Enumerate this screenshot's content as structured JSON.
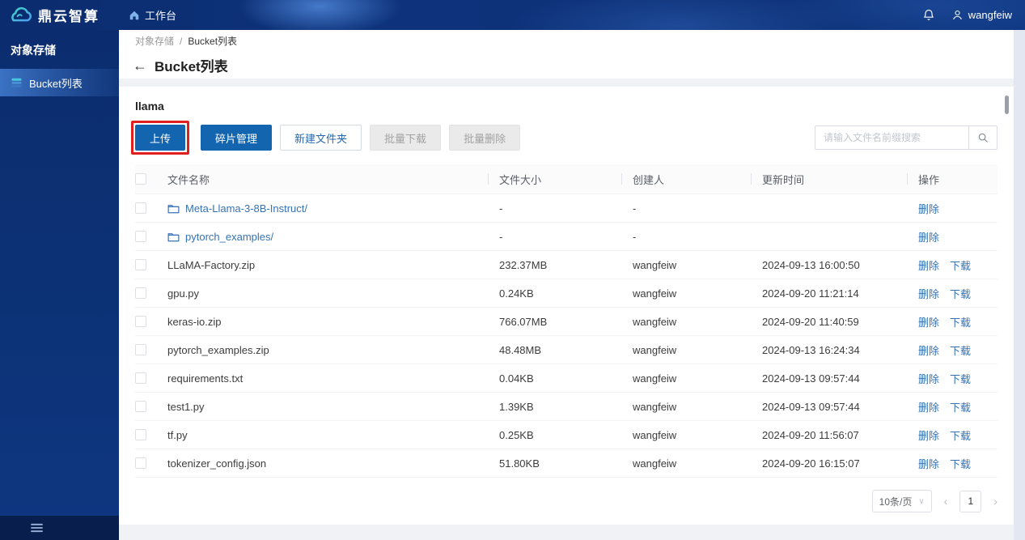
{
  "brand": {
    "logo_text": "鼎云智算"
  },
  "topbar": {
    "workspace_label": "工作台",
    "username": "wangfeiw"
  },
  "sidebar": {
    "section_title": "对象存储",
    "items": [
      {
        "label": "Bucket列表",
        "active": true
      }
    ]
  },
  "breadcrumb": {
    "parent": "对象存储",
    "separator": "/",
    "current": "Bucket列表"
  },
  "page": {
    "back_arrow": "←",
    "title": "Bucket列表"
  },
  "bucket": {
    "name": "llama"
  },
  "toolbar": {
    "upload_label": "上传",
    "fragment_manage_label": "碎片管理",
    "new_folder_label": "新建文件夹",
    "batch_download_label": "批量下载",
    "batch_delete_label": "批量删除"
  },
  "search": {
    "placeholder": "请输入文件名前缀搜索"
  },
  "annotation": {
    "color": "#e01f1f"
  },
  "table": {
    "headers": [
      "文件名称",
      "文件大小",
      "创建人",
      "更新时间",
      "操作"
    ],
    "action_labels": {
      "delete": "删除",
      "download": "下载"
    },
    "rows": [
      {
        "name": "Meta-Llama-3-8B-Instruct/",
        "type": "folder",
        "size": "-",
        "creator": "-",
        "updated": "",
        "downloadable": false
      },
      {
        "name": "pytorch_examples/",
        "type": "folder",
        "size": "-",
        "creator": "-",
        "updated": "",
        "downloadable": false
      },
      {
        "name": "LLaMA-Factory.zip",
        "type": "file",
        "size": "232.37MB",
        "creator": "wangfeiw",
        "updated": "2024-09-13 16:00:50",
        "downloadable": true
      },
      {
        "name": "gpu.py",
        "type": "file",
        "size": "0.24KB",
        "creator": "wangfeiw",
        "updated": "2024-09-20 11:21:14",
        "downloadable": true
      },
      {
        "name": "keras-io.zip",
        "type": "file",
        "size": "766.07MB",
        "creator": "wangfeiw",
        "updated": "2024-09-20 11:40:59",
        "downloadable": true
      },
      {
        "name": "pytorch_examples.zip",
        "type": "file",
        "size": "48.48MB",
        "creator": "wangfeiw",
        "updated": "2024-09-13 16:24:34",
        "downloadable": true
      },
      {
        "name": "requirements.txt",
        "type": "file",
        "size": "0.04KB",
        "creator": "wangfeiw",
        "updated": "2024-09-13 09:57:44",
        "downloadable": true
      },
      {
        "name": "test1.py",
        "type": "file",
        "size": "1.39KB",
        "creator": "wangfeiw",
        "updated": "2024-09-13 09:57:44",
        "downloadable": true
      },
      {
        "name": "tf.py",
        "type": "file",
        "size": "0.25KB",
        "creator": "wangfeiw",
        "updated": "2024-09-20 11:56:07",
        "downloadable": true
      },
      {
        "name": "tokenizer_config.json",
        "type": "file",
        "size": "51.80KB",
        "creator": "wangfeiw",
        "updated": "2024-09-20 16:15:07",
        "downloadable": true
      }
    ]
  },
  "pagination": {
    "page_size_label": "10条/页",
    "chevron": "∨",
    "prev": "‹",
    "current_page": "1",
    "next": "›"
  },
  "colors": {
    "primary_button": "#1365b0",
    "link": "#3572b3",
    "header_navy": "#0b2c6e"
  }
}
